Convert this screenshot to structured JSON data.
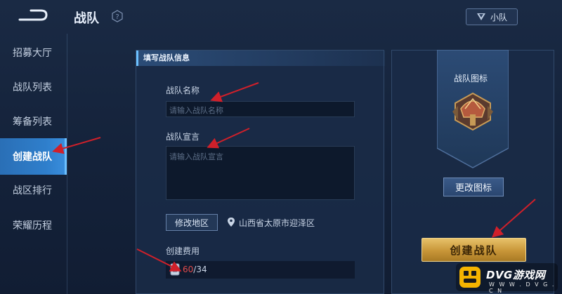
{
  "header": {
    "title": "战队",
    "team_button_label": "小队"
  },
  "sidebar": {
    "items": [
      {
        "label": "招募大厅",
        "active": false
      },
      {
        "label": "战队列表",
        "active": false
      },
      {
        "label": "筹备列表",
        "active": false
      },
      {
        "label": "创建战队",
        "active": true
      },
      {
        "label": "战区排行",
        "active": false
      },
      {
        "label": "荣耀历程",
        "active": false
      }
    ]
  },
  "form": {
    "section_title": "填写战队信息",
    "name_label": "战队名称",
    "name_placeholder": "请输入战队名称",
    "declaration_label": "战队宣言",
    "declaration_placeholder": "请输入战队宣言",
    "modify_region_label": "修改地区",
    "location": "山西省太原市迎泽区",
    "fee_label": "创建费用",
    "fee_current": "60",
    "fee_total": "/34"
  },
  "emblem": {
    "title": "战队图标",
    "change_label": "更改图标"
  },
  "actions": {
    "create_label": "创建战队"
  },
  "watermark": {
    "brand": "DVG游戏网",
    "url": "W W W . D V G . C N"
  },
  "colors": {
    "accent_blue": "#2f7fcc",
    "gold": "#c89638",
    "arrow_red": "#d0202a",
    "fee_red": "#e04b4b"
  }
}
